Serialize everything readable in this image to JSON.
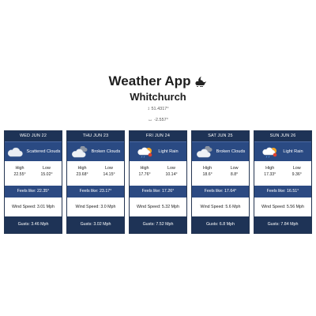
{
  "app": {
    "title": "Weather App",
    "title_icon": "cloud-moon-icon",
    "city": "Whitchurch",
    "lat": "51.4317°",
    "lon": "-2.557°"
  },
  "forecast": [
    {
      "day": "WED JUN 22",
      "condition": "Scattered Clouds",
      "icon": "scattered-clouds-icon",
      "high_label": "High",
      "high": "22.55°",
      "low_label": "Low",
      "low": "15.02°",
      "feels": "Feels like: 22.35°",
      "wind": "Wind Speed: 3.01 Mph",
      "gusts": "Gusts: 3.46 Mph"
    },
    {
      "day": "THU JUN 23",
      "condition": "Broken Clouds",
      "icon": "broken-clouds-icon",
      "high_label": "High",
      "high": "23.68°",
      "low_label": "Low",
      "low": "14.15°",
      "feels": "Feels like: 23.17°",
      "wind": "Wind Speed: 3.0 Mph",
      "gusts": "Gusts: 3.02 Mph"
    },
    {
      "day": "FRI JUN 24",
      "condition": "Light Rain",
      "icon": "light-rain-icon",
      "high_label": "High",
      "high": "17.76°",
      "low_label": "Low",
      "low": "10.14°",
      "feels": "Feels like: 17.26°",
      "wind": "Wind Speed: 5.32 Mph",
      "gusts": "Gusts: 7.52 Mph"
    },
    {
      "day": "SAT JUN 25",
      "condition": "Broken Clouds",
      "icon": "broken-clouds-icon",
      "high_label": "High",
      "high": "18.6°",
      "low_label": "Low",
      "low": "8.8°",
      "feels": "Feels like: 17.64°",
      "wind": "Wind Speed: 5.6 Mph",
      "gusts": "Gusts: 6.8 Mph"
    },
    {
      "day": "SUN JUN 26",
      "condition": "Light Rain",
      "icon": "light-rain-icon",
      "high_label": "High",
      "high": "17.33°",
      "low_label": "Low",
      "low": "9.36°",
      "feels": "Feels like: 16.51°",
      "wind": "Wind Speed: 5.56 Mph",
      "gusts": "Gusts: 7.84 Mph"
    }
  ],
  "colors": {
    "dark_navy": "#1e3356",
    "mid_blue": "#2a4a83",
    "white": "#ffffff"
  }
}
